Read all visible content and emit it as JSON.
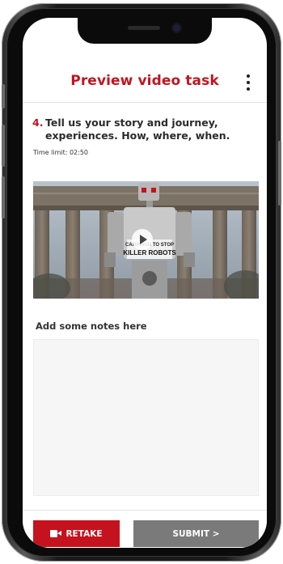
{
  "header": {
    "title": "Preview video task",
    "menu_icon": "more-vertical-icon"
  },
  "question": {
    "number": "4.",
    "text": "Tell us your story and journey, experiences. How, where, when.",
    "time_limit": "Time limit: 02:50"
  },
  "video": {
    "thumbnail_sign_line1": "CAMPAIGN TO STOP",
    "thumbnail_sign_line2": "KILLER ROBOTS",
    "play_icon": "play-icon"
  },
  "notes": {
    "label": "Add some notes here",
    "value": "",
    "placeholder": ""
  },
  "footer": {
    "retake_label": "RETAKE",
    "retake_icon": "video-camera-icon",
    "submit_label": "SUBMIT >"
  },
  "colors": {
    "accent": "#c4131f",
    "submit_bg": "#7a7a7a",
    "notes_bg": "#f6f6f6"
  }
}
